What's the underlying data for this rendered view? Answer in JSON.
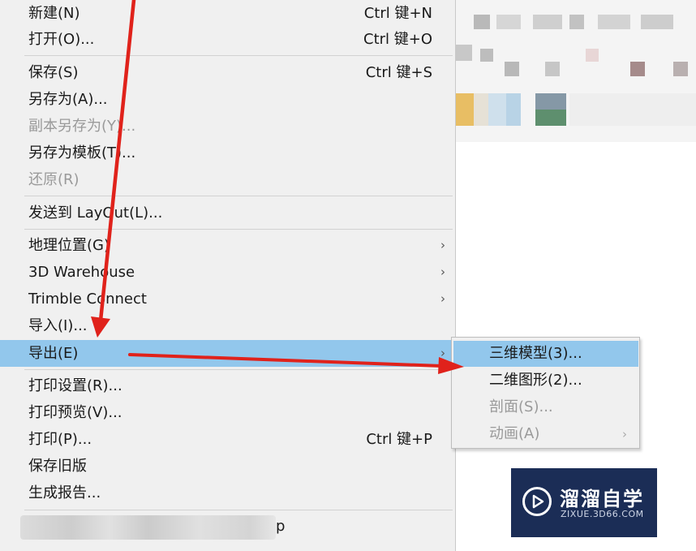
{
  "file_menu": {
    "items": [
      {
        "label": "新建(N)",
        "shortcut": "Ctrl 键+N"
      },
      {
        "label": "打开(O)...",
        "shortcut": "Ctrl 键+O"
      },
      {
        "label": "保存(S)",
        "shortcut": "Ctrl 键+S"
      },
      {
        "label": "另存为(A)..."
      },
      {
        "label": "副本另存为(Y)..."
      },
      {
        "label": "另存为模板(T)..."
      },
      {
        "label": "还原(R)"
      },
      {
        "label": "发送到 LayOut(L)..."
      },
      {
        "label": "地理位置(G)"
      },
      {
        "label": "3D Warehouse"
      },
      {
        "label": "Trimble Connect"
      },
      {
        "label": "导入(I)..."
      },
      {
        "label": "导出(E)"
      },
      {
        "label": "打印设置(R)..."
      },
      {
        "label": "打印预览(V)..."
      },
      {
        "label": "打印(P)...",
        "shortcut": "Ctrl 键+P"
      },
      {
        "label": "保存旧版"
      },
      {
        "label": "生成报告..."
      }
    ],
    "submenu_arrow": "›",
    "bottom_item_tail": "p"
  },
  "export_submenu": {
    "items": [
      {
        "label": "三维模型(3)..."
      },
      {
        "label": "二维图形(2)..."
      },
      {
        "label": "剖面(S)..."
      },
      {
        "label": "动画(A)"
      }
    ]
  },
  "watermark": {
    "title": "溜溜自学",
    "subtitle": "ZIXUE.3D66.COM"
  },
  "colors": {
    "highlight": "#92c7ec",
    "arrow": "#e0221b",
    "watermark_bg": "#1b2d56"
  }
}
